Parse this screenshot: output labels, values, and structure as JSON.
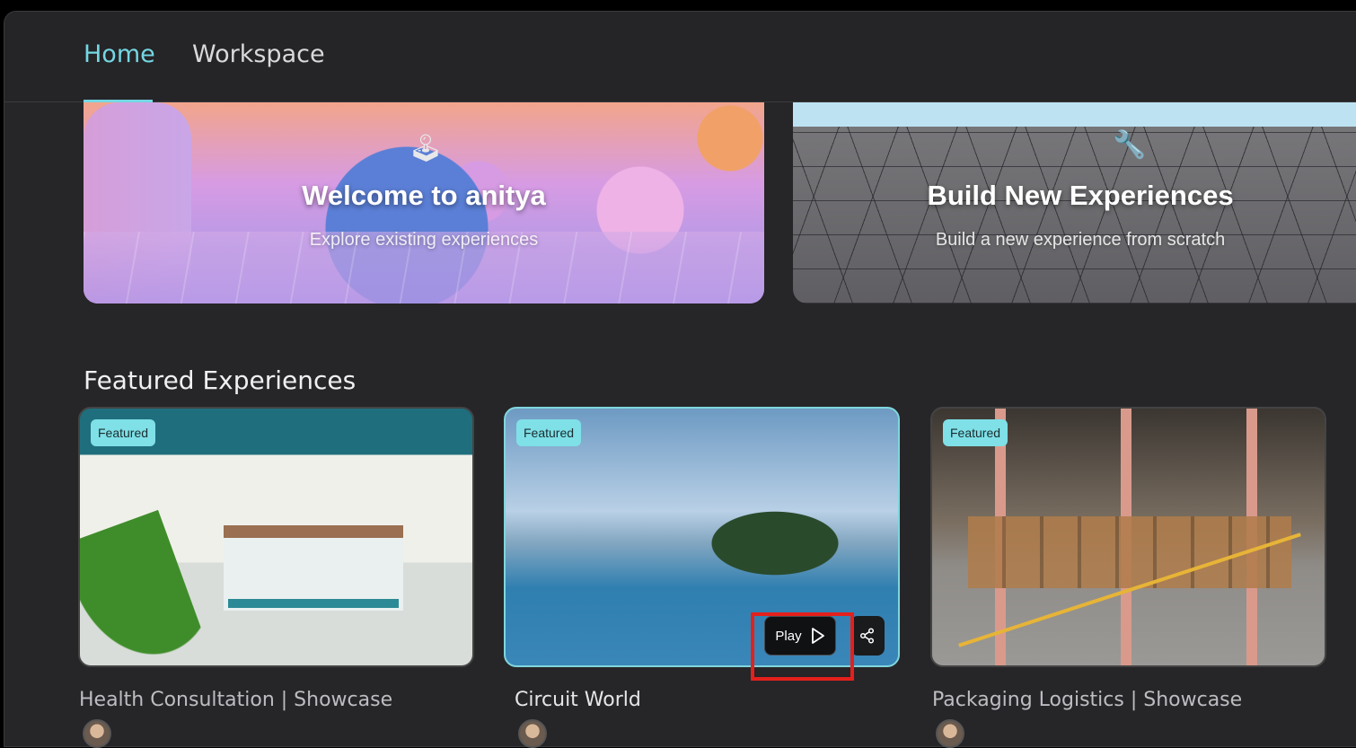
{
  "nav": {
    "tabs": [
      {
        "label": "Home",
        "active": true
      },
      {
        "label": "Workspace",
        "active": false
      }
    ]
  },
  "hero": {
    "welcome": {
      "title": "Welcome to anitya",
      "subtitle": "Explore existing experiences",
      "icon": "joystick-icon"
    },
    "build": {
      "title": "Build New Experiences",
      "subtitle": "Build a new experience from scratch",
      "icon": "wrench-icon"
    }
  },
  "featured": {
    "section_title": "Featured Experiences",
    "cards": [
      {
        "badge": "Featured",
        "title": "Health Consultation | Showcase"
      },
      {
        "badge": "Featured",
        "title": "Circuit World",
        "play_label": "Play",
        "play_icon": "play-icon",
        "share_icon": "share-icon"
      },
      {
        "badge": "Featured",
        "title": "Packaging Logistics | Showcase"
      }
    ]
  },
  "colors": {
    "accent": "#74d7e3",
    "badge": "#7fe0e7",
    "highlight": "#e4201c",
    "background": "#262528"
  }
}
